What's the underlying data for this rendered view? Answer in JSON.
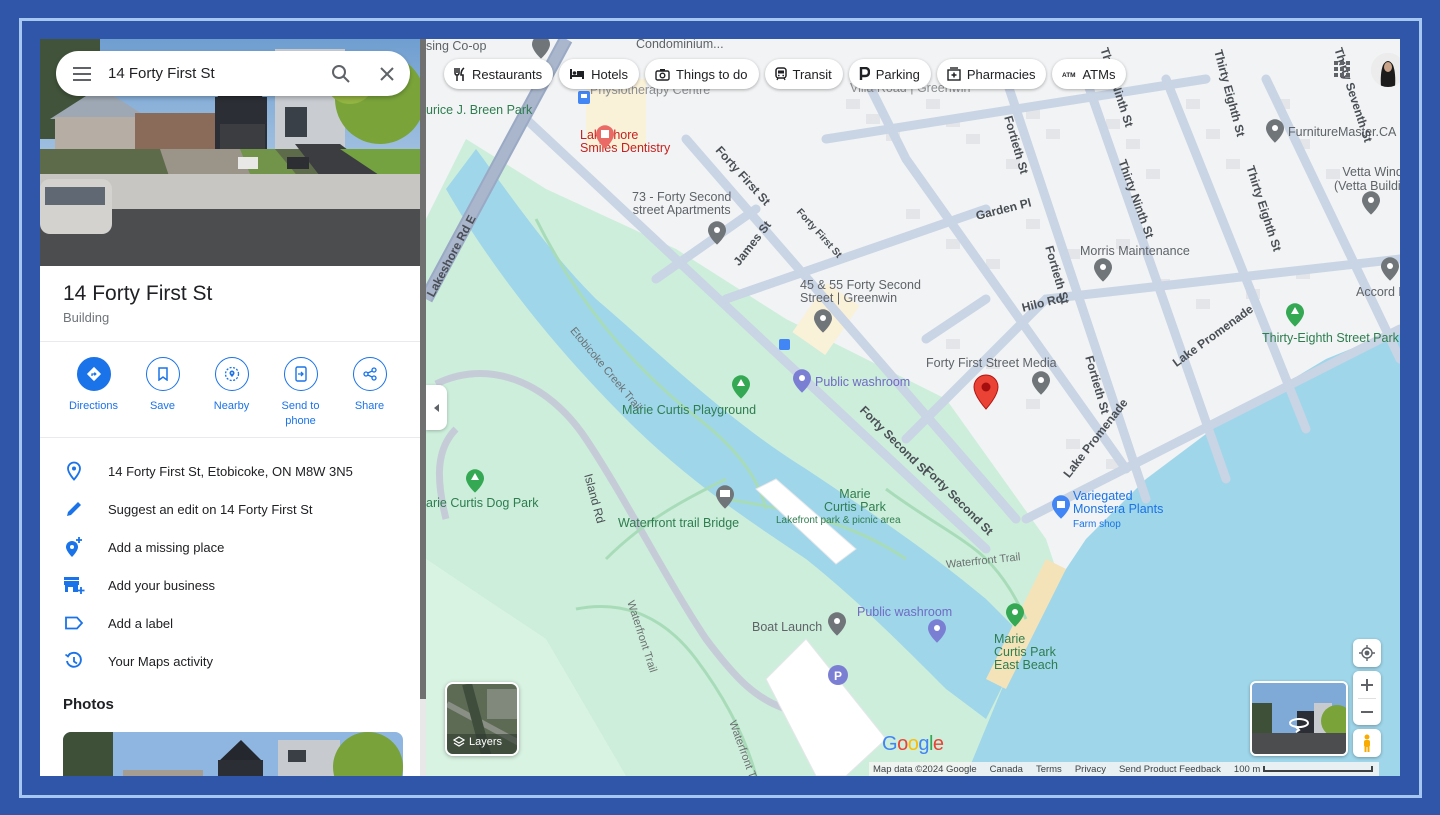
{
  "search": {
    "value": "14 Forty First St",
    "menu_icon": "hamburger-menu-icon",
    "search_icon": "search-icon",
    "clear_icon": "close-icon"
  },
  "place": {
    "title": "14 Forty First St",
    "category": "Building"
  },
  "actions": [
    {
      "label": "Directions",
      "icon": "directions-icon"
    },
    {
      "label": "Save",
      "icon": "bookmark-icon"
    },
    {
      "label": "Nearby",
      "icon": "nearby-icon"
    },
    {
      "label": "Send to phone",
      "icon": "send-to-phone-icon"
    },
    {
      "label": "Share",
      "icon": "share-icon"
    }
  ],
  "info_rows": [
    {
      "text": "14 Forty First St, Etobicoke, ON M8W 3N5",
      "icon": "location-pin-icon"
    },
    {
      "text": "Suggest an edit on 14 Forty First St",
      "icon": "pencil-icon"
    },
    {
      "text": "Add a missing place",
      "icon": "add-place-icon"
    },
    {
      "text": "Add your business",
      "icon": "add-business-icon"
    },
    {
      "text": "Add a label",
      "icon": "label-icon"
    },
    {
      "text": "Your Maps activity",
      "icon": "history-icon"
    }
  ],
  "photos_heading": "Photos",
  "chips": [
    {
      "label": "Restaurants",
      "icon": "fork-knife-icon"
    },
    {
      "label": "Hotels",
      "icon": "bed-icon"
    },
    {
      "label": "Things to do",
      "icon": "camera-icon"
    },
    {
      "label": "Transit",
      "icon": "train-icon"
    },
    {
      "label": "Parking",
      "icon": "parking-icon"
    },
    {
      "label": "Pharmacies",
      "icon": "pharmacy-icon"
    },
    {
      "label": "ATMs",
      "icon": "atm-icon"
    }
  ],
  "map_labels": {
    "housing_coop": "sing Co-op",
    "condominium": "Condominium...",
    "physio": "Physiotherapy Centre",
    "villa_road": "Villa Road | Greenwin",
    "breen_park": "urice J. Breen Park",
    "dentistry": "Lakeshore\nSmiles Dentistry",
    "apartments_73": "73 - Forty Second\nstreet Apartments",
    "greenwin_45": "45 & 55 Forty Second\nStreet | Greenwin",
    "furniture": "FurnitureMaster.CA",
    "vetta": "Vetta Windows\n(Vetta Building...",
    "morris": "Morris Maintenance",
    "accord": "Accord Hart",
    "thirty_eighth_park": "Thirty-Eighth Street Park",
    "forty_first_media": "Forty First Street Media",
    "public_washroom_1": "Public washroom",
    "public_washroom_2": "Public washroom",
    "playground": "Marie Curtis Playground",
    "dog_park": "arie Curtis Dog Park",
    "trail_bridge": "Waterfront trail Bridge",
    "marie_curtis_park": "Marie\nCurtis Park",
    "marie_curtis_park_sub": "Lakefront park & picnic area",
    "variegated": "Variegated\nMonstera Plants",
    "variegated_sub": "Farm shop",
    "boat_launch": "Boat Launch",
    "east_beach": "Marie\nCurtis Park\nEast Beach"
  },
  "road_labels": {
    "lakeshore": "Lakeshore Rd E",
    "forty_first_1": "Forty First St",
    "forty_first_2": "Forty First St",
    "james": "James St",
    "fortieth_1": "Fortieth St",
    "fortieth_2": "Fortieth St",
    "fortieth_3": "Fortieth St",
    "thirty_ninth": "Thirty Ninth St",
    "thirty_eighth": "Thirty Eighth St",
    "thirty_eighth_top": "Thirty Eighth St",
    "thirty_seventh": "Thirty Seventh St",
    "thirty_ninth_top": "Thirty Ninth St",
    "garden": "Garden Pl",
    "hilo": "Hilo Rd",
    "forty_second_1": "Forty Second St",
    "forty_second_2": "Forty Second St",
    "lake_promenade_1": "Lake Promenade",
    "lake_promenade_2": "Lake Promenade",
    "island": "Island Rd",
    "etobicoke_trail": "Etobicoke Creek Trail",
    "waterfront_trail_1": "Waterfront Trail",
    "waterfront_trail_2": "Waterfront Trail",
    "waterfront_trail_3": "Waterfront T"
  },
  "layers_label": "Layers",
  "google_logo": [
    "G",
    "o",
    "o",
    "g",
    "l",
    "e"
  ],
  "footer": {
    "map_data": "Map data ©2024 Google",
    "region": "Canada",
    "terms": "Terms",
    "privacy": "Privacy",
    "feedback": "Send Product Feedback",
    "scale": "100 m"
  },
  "colors": {
    "accent": "#1a73e8",
    "pin_red": "#ea4335",
    "park_green": "#c8ecd3",
    "water_blue": "#9fd6ea",
    "frame_blue": "#2f56a9"
  }
}
